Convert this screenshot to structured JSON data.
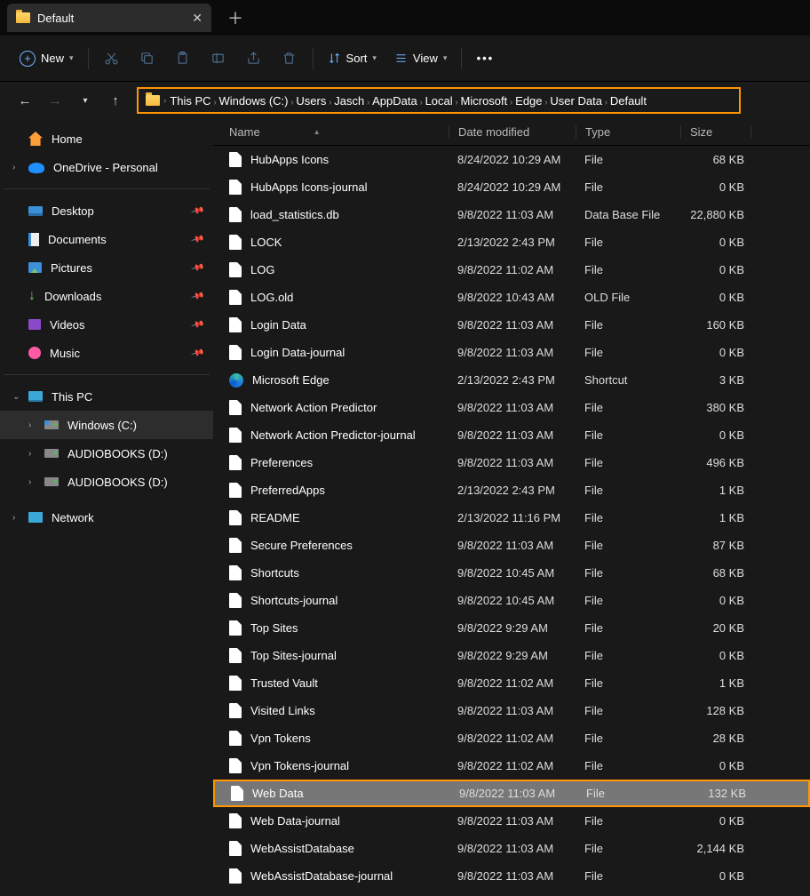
{
  "tab": {
    "title": "Default"
  },
  "toolbar": {
    "new": "New",
    "sort": "Sort",
    "view": "View"
  },
  "breadcrumb": [
    "This PC",
    "Windows (C:)",
    "Users",
    "Jasch",
    "AppData",
    "Local",
    "Microsoft",
    "Edge",
    "User Data",
    "Default"
  ],
  "sidebar": {
    "home": "Home",
    "onedrive": "OneDrive - Personal",
    "quick": [
      {
        "label": "Desktop"
      },
      {
        "label": "Documents"
      },
      {
        "label": "Pictures"
      },
      {
        "label": "Downloads"
      },
      {
        "label": "Videos"
      },
      {
        "label": "Music"
      }
    ],
    "thispc": "This PC",
    "drives": [
      {
        "label": "Windows (C:)"
      },
      {
        "label": "AUDIOBOOKS (D:)"
      },
      {
        "label": "AUDIOBOOKS (D:)"
      }
    ],
    "network": "Network"
  },
  "columns": {
    "name": "Name",
    "date": "Date modified",
    "type": "Type",
    "size": "Size"
  },
  "files": [
    {
      "name": "HubApps Icons",
      "date": "8/24/2022 10:29 AM",
      "type": "File",
      "size": "68 KB",
      "icon": "file"
    },
    {
      "name": "HubApps Icons-journal",
      "date": "8/24/2022 10:29 AM",
      "type": "File",
      "size": "0 KB",
      "icon": "file"
    },
    {
      "name": "load_statistics.db",
      "date": "9/8/2022 11:03 AM",
      "type": "Data Base File",
      "size": "22,880 KB",
      "icon": "file"
    },
    {
      "name": "LOCK",
      "date": "2/13/2022 2:43 PM",
      "type": "File",
      "size": "0 KB",
      "icon": "file"
    },
    {
      "name": "LOG",
      "date": "9/8/2022 11:02 AM",
      "type": "File",
      "size": "0 KB",
      "icon": "file"
    },
    {
      "name": "LOG.old",
      "date": "9/8/2022 10:43 AM",
      "type": "OLD File",
      "size": "0 KB",
      "icon": "file"
    },
    {
      "name": "Login Data",
      "date": "9/8/2022 11:03 AM",
      "type": "File",
      "size": "160 KB",
      "icon": "file"
    },
    {
      "name": "Login Data-journal",
      "date": "9/8/2022 11:03 AM",
      "type": "File",
      "size": "0 KB",
      "icon": "file"
    },
    {
      "name": "Microsoft Edge",
      "date": "2/13/2022 2:43 PM",
      "type": "Shortcut",
      "size": "3 KB",
      "icon": "edge"
    },
    {
      "name": "Network Action Predictor",
      "date": "9/8/2022 11:03 AM",
      "type": "File",
      "size": "380 KB",
      "icon": "file"
    },
    {
      "name": "Network Action Predictor-journal",
      "date": "9/8/2022 11:03 AM",
      "type": "File",
      "size": "0 KB",
      "icon": "file"
    },
    {
      "name": "Preferences",
      "date": "9/8/2022 11:03 AM",
      "type": "File",
      "size": "496 KB",
      "icon": "file"
    },
    {
      "name": "PreferredApps",
      "date": "2/13/2022 2:43 PM",
      "type": "File",
      "size": "1 KB",
      "icon": "file"
    },
    {
      "name": "README",
      "date": "2/13/2022 11:16 PM",
      "type": "File",
      "size": "1 KB",
      "icon": "file"
    },
    {
      "name": "Secure Preferences",
      "date": "9/8/2022 11:03 AM",
      "type": "File",
      "size": "87 KB",
      "icon": "file"
    },
    {
      "name": "Shortcuts",
      "date": "9/8/2022 10:45 AM",
      "type": "File",
      "size": "68 KB",
      "icon": "file"
    },
    {
      "name": "Shortcuts-journal",
      "date": "9/8/2022 10:45 AM",
      "type": "File",
      "size": "0 KB",
      "icon": "file"
    },
    {
      "name": "Top Sites",
      "date": "9/8/2022 9:29 AM",
      "type": "File",
      "size": "20 KB",
      "icon": "file"
    },
    {
      "name": "Top Sites-journal",
      "date": "9/8/2022 9:29 AM",
      "type": "File",
      "size": "0 KB",
      "icon": "file"
    },
    {
      "name": "Trusted Vault",
      "date": "9/8/2022 11:02 AM",
      "type": "File",
      "size": "1 KB",
      "icon": "file"
    },
    {
      "name": "Visited Links",
      "date": "9/8/2022 11:03 AM",
      "type": "File",
      "size": "128 KB",
      "icon": "file"
    },
    {
      "name": "Vpn Tokens",
      "date": "9/8/2022 11:02 AM",
      "type": "File",
      "size": "28 KB",
      "icon": "file"
    },
    {
      "name": "Vpn Tokens-journal",
      "date": "9/8/2022 11:02 AM",
      "type": "File",
      "size": "0 KB",
      "icon": "file"
    },
    {
      "name": "Web Data",
      "date": "9/8/2022 11:03 AM",
      "type": "File",
      "size": "132 KB",
      "icon": "file",
      "highlight": true
    },
    {
      "name": "Web Data-journal",
      "date": "9/8/2022 11:03 AM",
      "type": "File",
      "size": "0 KB",
      "icon": "file"
    },
    {
      "name": "WebAssistDatabase",
      "date": "9/8/2022 11:03 AM",
      "type": "File",
      "size": "2,144 KB",
      "icon": "file"
    },
    {
      "name": "WebAssistDatabase-journal",
      "date": "9/8/2022 11:03 AM",
      "type": "File",
      "size": "0 KB",
      "icon": "file"
    }
  ]
}
